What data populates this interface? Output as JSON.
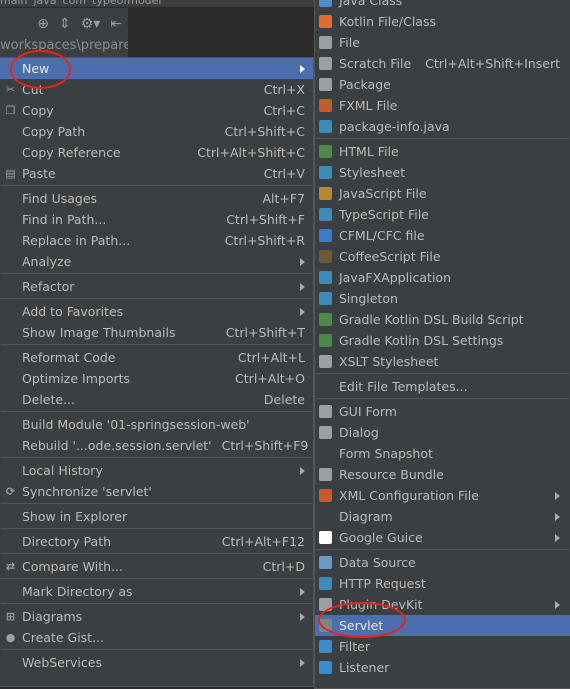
{
  "tabs": [
    "main",
    "java",
    "com",
    "typeofmodel"
  ],
  "path_text": "workspaces\\prepareLe",
  "left_menu": [
    {
      "label": "New",
      "submenu": true,
      "selected": true
    },
    {
      "label": "Cut",
      "shortcut": "Ctrl+X",
      "icon": "scissors-icon"
    },
    {
      "label": "Copy",
      "shortcut": "Ctrl+C",
      "icon": "copy-icon"
    },
    {
      "label": "Copy Path",
      "shortcut": "Ctrl+Shift+C"
    },
    {
      "label": "Copy Reference",
      "shortcut": "Ctrl+Alt+Shift+C"
    },
    {
      "label": "Paste",
      "shortcut": "Ctrl+V",
      "icon": "paste-icon"
    },
    {
      "sep": true
    },
    {
      "label": "Find Usages",
      "shortcut": "Alt+F7"
    },
    {
      "label": "Find in Path...",
      "shortcut": "Ctrl+Shift+F"
    },
    {
      "label": "Replace in Path...",
      "shortcut": "Ctrl+Shift+R"
    },
    {
      "label": "Analyze",
      "submenu": true
    },
    {
      "sep": true
    },
    {
      "label": "Refactor",
      "submenu": true
    },
    {
      "sep": true
    },
    {
      "label": "Add to Favorites",
      "submenu": true
    },
    {
      "label": "Show Image Thumbnails",
      "shortcut": "Ctrl+Shift+T"
    },
    {
      "sep": true
    },
    {
      "label": "Reformat Code",
      "shortcut": "Ctrl+Alt+L"
    },
    {
      "label": "Optimize Imports",
      "shortcut": "Ctrl+Alt+O"
    },
    {
      "label": "Delete...",
      "shortcut": "Delete"
    },
    {
      "sep": true
    },
    {
      "label": "Build Module '01-springsession-web'"
    },
    {
      "label": "Rebuild '...ode.session.servlet'",
      "shortcut": "Ctrl+Shift+F9"
    },
    {
      "sep": true
    },
    {
      "label": "Local History",
      "submenu": true
    },
    {
      "label": "Synchronize 'servlet'",
      "icon": "sync-icon"
    },
    {
      "sep": true
    },
    {
      "label": "Show in Explorer"
    },
    {
      "sep": true
    },
    {
      "label": "Directory Path",
      "shortcut": "Ctrl+Alt+F12"
    },
    {
      "sep": true
    },
    {
      "label": "Compare With...",
      "shortcut": "Ctrl+D",
      "icon": "compare-icon"
    },
    {
      "sep": true
    },
    {
      "label": "Mark Directory as",
      "submenu": true
    },
    {
      "sep": true
    },
    {
      "label": "Diagrams",
      "submenu": true,
      "icon": "diagram-icon"
    },
    {
      "label": "Create Gist...",
      "icon": "github-icon"
    },
    {
      "sep": true
    },
    {
      "label": "WebServices",
      "submenu": true
    }
  ],
  "right_menu": [
    {
      "label": "Java Class",
      "icon": "java-class-icon",
      "color": "#4a8fc9"
    },
    {
      "label": "Kotlin File/Class",
      "icon": "kotlin-icon",
      "color": "#e66a2c"
    },
    {
      "label": "File",
      "icon": "file-icon",
      "color": "#9aa0a4"
    },
    {
      "label": "Scratch File",
      "shortcut": "Ctrl+Alt+Shift+Insert",
      "icon": "scratch-file-icon",
      "color": "#9aa0a4"
    },
    {
      "label": "Package",
      "icon": "package-icon",
      "color": "#9aa0a4"
    },
    {
      "label": "FXML File",
      "icon": "fxml-icon",
      "color": "#c75a2a"
    },
    {
      "label": "package-info.java",
      "icon": "package-info-icon",
      "color": "#3d8bb8"
    },
    {
      "sep": true
    },
    {
      "label": "HTML File",
      "icon": "html-icon",
      "color": "#4c8a4c"
    },
    {
      "label": "Stylesheet",
      "icon": "css-icon",
      "color": "#3d8bb8"
    },
    {
      "label": "JavaScript File",
      "icon": "js-icon",
      "color": "#b58a2a"
    },
    {
      "label": "TypeScript File",
      "icon": "ts-icon",
      "color": "#3d8bb8"
    },
    {
      "label": "CFML/CFC file",
      "icon": "cfml-icon",
      "color": "#3d7bc8"
    },
    {
      "label": "CoffeeScript File",
      "icon": "coffeescript-icon",
      "color": "#6b5a3a"
    },
    {
      "label": "JavaFXApplication",
      "icon": "javafx-icon",
      "color": "#3d8bb8"
    },
    {
      "label": "Singleton",
      "icon": "singleton-icon",
      "color": "#3d8bb8"
    },
    {
      "label": "Gradle Kotlin DSL Build Script",
      "icon": "gradle-icon",
      "color": "#4c8a4c"
    },
    {
      "label": "Gradle Kotlin DSL Settings",
      "icon": "gradle-icon",
      "color": "#4c8a4c"
    },
    {
      "label": "XSLT Stylesheet",
      "icon": "xslt-icon",
      "color": "#9aa0a4"
    },
    {
      "sep": true
    },
    {
      "label": "Edit File Templates..."
    },
    {
      "sep": true
    },
    {
      "label": "GUI Form",
      "icon": "gui-form-icon",
      "color": "#9aa0a4"
    },
    {
      "label": "Dialog",
      "icon": "dialog-icon",
      "color": "#9aa0a4"
    },
    {
      "label": "Form Snapshot"
    },
    {
      "label": "Resource Bundle",
      "icon": "resource-bundle-icon",
      "color": "#9aa0a4"
    },
    {
      "label": "XML Configuration File",
      "submenu": true,
      "icon": "xml-icon",
      "color": "#c75a2a"
    },
    {
      "label": "Diagram",
      "submenu": true
    },
    {
      "label": "Google Guice",
      "submenu": true,
      "icon": "guice-icon",
      "color": "#ffffff"
    },
    {
      "sep": true
    },
    {
      "label": "Data Source",
      "icon": "database-icon",
      "color": "#6a9ac8"
    },
    {
      "label": "HTTP Request",
      "icon": "api-icon",
      "color": "#3d8bb8"
    },
    {
      "label": "Plugin DevKit",
      "submenu": true,
      "icon": "plugin-icon",
      "color": "#9aa0a4"
    },
    {
      "label": "Servlet",
      "icon": "servlet-icon",
      "color": "#7a8a7a",
      "selected": true
    },
    {
      "label": "Filter",
      "icon": "filter-icon",
      "color": "#3d8bc8"
    },
    {
      "label": "Listener",
      "icon": "listener-icon",
      "color": "#3d8bc8"
    }
  ],
  "colors": {
    "menu_bg": "#3c3f41",
    "selection": "#4b6eaf",
    "annotation": "#e8231a"
  }
}
